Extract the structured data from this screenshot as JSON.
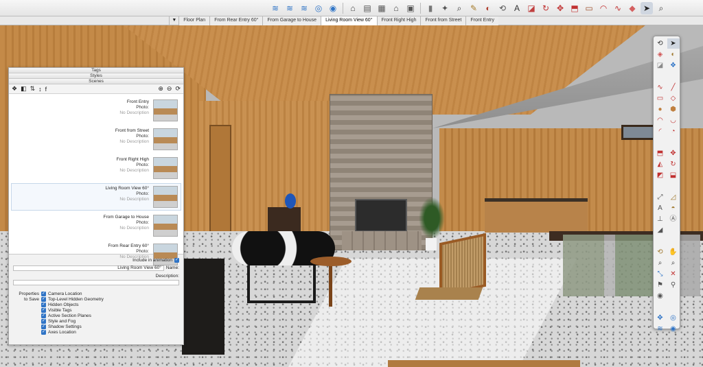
{
  "toolbar": {
    "buttons": [
      {
        "icon": "sandbox-from-contours-icon",
        "glyph": "≋",
        "color": "#2f74c6"
      },
      {
        "icon": "sandbox-from-scratch-icon",
        "glyph": "≋",
        "color": "#2f74c6"
      },
      {
        "icon": "smoove-icon",
        "glyph": "≋",
        "color": "#2f74c6"
      },
      {
        "icon": "stamp-icon",
        "glyph": "◎",
        "color": "#2f74c6"
      },
      {
        "icon": "drape-icon",
        "glyph": "◉",
        "color": "#2f74c6"
      },
      {
        "icon": "sep",
        "glyph": "",
        "color": ""
      },
      {
        "icon": "home-icon",
        "glyph": "⌂",
        "color": "#444"
      },
      {
        "icon": "warehouse-icon",
        "glyph": "▤",
        "color": "#555"
      },
      {
        "icon": "extension-icon",
        "glyph": "▦",
        "color": "#555"
      },
      {
        "icon": "home-outline-icon",
        "glyph": "⌂",
        "color": "#444"
      },
      {
        "icon": "layout-icon",
        "glyph": "▣",
        "color": "#555"
      },
      {
        "icon": "sep",
        "glyph": "",
        "color": ""
      },
      {
        "icon": "shadow-icon",
        "glyph": "▮",
        "color": "#777"
      },
      {
        "icon": "section-icon",
        "glyph": "✦",
        "color": "#555"
      },
      {
        "icon": "zoom-icon",
        "glyph": "⌕",
        "color": "#333"
      },
      {
        "icon": "tape-measure-icon",
        "glyph": "✎",
        "color": "#a67c2a"
      },
      {
        "icon": "paint-bucket-icon",
        "glyph": "◐",
        "color": "#b0402f"
      },
      {
        "icon": "orbit-icon",
        "glyph": "⟲",
        "color": "#555"
      },
      {
        "icon": "text-icon",
        "glyph": "A",
        "color": "#333"
      },
      {
        "icon": "eraser-icon",
        "glyph": "◪",
        "color": "#c04040"
      },
      {
        "icon": "rotate-icon",
        "glyph": "↻",
        "color": "#c03030"
      },
      {
        "icon": "move-icon",
        "glyph": "✥",
        "color": "#c03030"
      },
      {
        "icon": "pushpull-icon",
        "glyph": "⬒",
        "color": "#c03030"
      },
      {
        "icon": "rectangle-icon",
        "glyph": "▭",
        "color": "#a0522d"
      },
      {
        "icon": "arc-icon",
        "glyph": "◠",
        "color": "#c03030"
      },
      {
        "icon": "freehand-icon",
        "glyph": "∿",
        "color": "#c03030"
      },
      {
        "icon": "eraser-tool-icon",
        "glyph": "◆",
        "color": "#d46060"
      },
      {
        "icon": "select-icon",
        "glyph": "➤",
        "color": "#222",
        "active": true
      },
      {
        "icon": "search-icon",
        "glyph": "⌕",
        "color": "#333"
      }
    ]
  },
  "scene_tabs": {
    "menu_glyph": "▼",
    "items": [
      {
        "label": "Floor Plan",
        "active": false
      },
      {
        "label": "From Rear Entry 60°",
        "active": false
      },
      {
        "label": "From Garage to House",
        "active": false
      },
      {
        "label": "Living Room View 60°",
        "active": true
      },
      {
        "label": "Front Right High",
        "active": false
      },
      {
        "label": "Front from Street",
        "active": false
      },
      {
        "label": "Front Entry",
        "active": false
      }
    ]
  },
  "tray": {
    "headers": [
      "Tags",
      "Styles",
      "Scenes"
    ],
    "tools": {
      "update": "⟳",
      "remove": "⊖",
      "add": "⊕",
      "details": "f",
      "sort": "↕",
      "view_options": "⇅",
      "scenes_icon": "❖",
      "thumbnail_icon": "◧"
    },
    "scenes": [
      {
        "name": "Front Entry",
        "photo": "Photo:",
        "desc": "No Description",
        "selected": false
      },
      {
        "name": "Front from Street",
        "photo": "Photo:",
        "desc": "No Description",
        "selected": false
      },
      {
        "name": "Front Right High",
        "photo": "Photo:",
        "desc": "No Description",
        "selected": false
      },
      {
        "name": "Living Room View 60°",
        "photo": "Photo:",
        "desc": "No Description",
        "selected": true
      },
      {
        "name": "From Garage to House",
        "photo": "Photo:",
        "desc": "No Description",
        "selected": false
      },
      {
        "name": "From Rear Entry 60°",
        "photo": "Photo:",
        "desc": "No Description",
        "selected": false
      }
    ],
    "include_in_animation": "Include in animation",
    "name_label": "Name:",
    "name_value": "Living Room View 60°",
    "description_label": "Description:",
    "description_value": "",
    "properties_label": "Properties",
    "to_save_label": "to Save",
    "properties": [
      "Camera Location",
      "Top-Level Hidden Geometry",
      "Hidden Objects",
      "Visible Tags",
      "Active Section Planes",
      "Style and Fog",
      "Shadow Settings",
      "Axes Location"
    ]
  },
  "palette": {
    "buttons": [
      {
        "icon": "orbit-icon",
        "glyph": "⟲",
        "color": "#333"
      },
      {
        "icon": "select-icon",
        "glyph": "➤",
        "color": "#222",
        "active": true
      },
      {
        "icon": "tag-icon",
        "glyph": "◈",
        "color": "#d05050"
      },
      {
        "icon": "paint-bucket-icon",
        "glyph": "◐",
        "color": "#a07a30"
      },
      {
        "icon": "eraser-icon",
        "glyph": "◪",
        "color": "#8a8a8a"
      },
      {
        "icon": "component-icon",
        "glyph": "❖",
        "color": "#2f74c6"
      },
      {
        "icon": "gap",
        "glyph": "",
        "color": ""
      },
      {
        "icon": "freehand-icon",
        "glyph": "∿",
        "color": "#c03030"
      },
      {
        "icon": "line-icon",
        "glyph": "╱",
        "color": "#c03030"
      },
      {
        "icon": "rectangle-icon",
        "glyph": "▭",
        "color": "#c03030"
      },
      {
        "icon": "rotated-rectangle-icon",
        "glyph": "◇",
        "color": "#c03030"
      },
      {
        "icon": "circle-icon",
        "glyph": "●",
        "color": "#c08040"
      },
      {
        "icon": "polygon-icon",
        "glyph": "⬢",
        "color": "#c08040"
      },
      {
        "icon": "arc-icon",
        "glyph": "◠",
        "color": "#c03030"
      },
      {
        "icon": "two-point-arc-icon",
        "glyph": "◡",
        "color": "#c03030"
      },
      {
        "icon": "three-point-arc-icon",
        "glyph": "◜",
        "color": "#c03030"
      },
      {
        "icon": "pie-icon",
        "glyph": "◔",
        "color": "#c03030"
      },
      {
        "icon": "gap",
        "glyph": "",
        "color": ""
      },
      {
        "icon": "pushpull-icon",
        "glyph": "⬒",
        "color": "#c03030"
      },
      {
        "icon": "move-icon",
        "glyph": "✥",
        "color": "#c03030"
      },
      {
        "icon": "follow-me-icon",
        "glyph": "◭",
        "color": "#c03030"
      },
      {
        "icon": "rotate-icon",
        "glyph": "↻",
        "color": "#c03030"
      },
      {
        "icon": "offset-icon",
        "glyph": "◩",
        "color": "#c03030"
      },
      {
        "icon": "scale-icon",
        "glyph": "⬓",
        "color": "#c03030"
      },
      {
        "icon": "gap",
        "glyph": "",
        "color": ""
      },
      {
        "icon": "tape-measure-icon",
        "glyph": "⤢",
        "color": "#555"
      },
      {
        "icon": "dimension-icon",
        "glyph": "◿",
        "color": "#a07a30"
      },
      {
        "icon": "text-icon",
        "glyph": "A",
        "color": "#555"
      },
      {
        "icon": "protractor-icon",
        "glyph": "◓",
        "color": "#a07a30"
      },
      {
        "icon": "axes-icon",
        "glyph": "⊥",
        "color": "#555"
      },
      {
        "icon": "3d-text-icon",
        "glyph": "Ⓐ",
        "color": "#555"
      },
      {
        "icon": "section-plane-icon",
        "glyph": "◢",
        "color": "#555"
      },
      {
        "icon": "gap",
        "glyph": "",
        "color": ""
      },
      {
        "icon": "orbit-tool-icon",
        "glyph": "⟲",
        "color": "#a07a30"
      },
      {
        "icon": "pan-icon",
        "glyph": "✋",
        "color": "#a07a30"
      },
      {
        "icon": "zoom-icon",
        "glyph": "⌕",
        "color": "#333"
      },
      {
        "icon": "zoom-window-icon",
        "glyph": "⌕",
        "color": "#333"
      },
      {
        "icon": "zoom-extents-icon",
        "glyph": "⤡",
        "color": "#2f74c6"
      },
      {
        "icon": "previous-view-icon",
        "glyph": "✕",
        "color": "#c03030"
      },
      {
        "icon": "position-camera-icon",
        "glyph": "⚑",
        "color": "#555"
      },
      {
        "icon": "walk-icon",
        "glyph": "⚲",
        "color": "#555"
      },
      {
        "icon": "look-around-icon",
        "glyph": "◉",
        "color": "#555"
      },
      {
        "icon": "gap",
        "glyph": "",
        "color": ""
      },
      {
        "icon": "section-fill-icon",
        "glyph": "✥",
        "color": "#2f74c6"
      },
      {
        "icon": "display-sections-icon",
        "glyph": "◎",
        "color": "#2f74c6"
      },
      {
        "icon": "sandbox-icon",
        "glyph": "≋",
        "color": "#2f74c6"
      },
      {
        "icon": "drape-icon",
        "glyph": "◉",
        "color": "#2f74c6"
      }
    ]
  }
}
